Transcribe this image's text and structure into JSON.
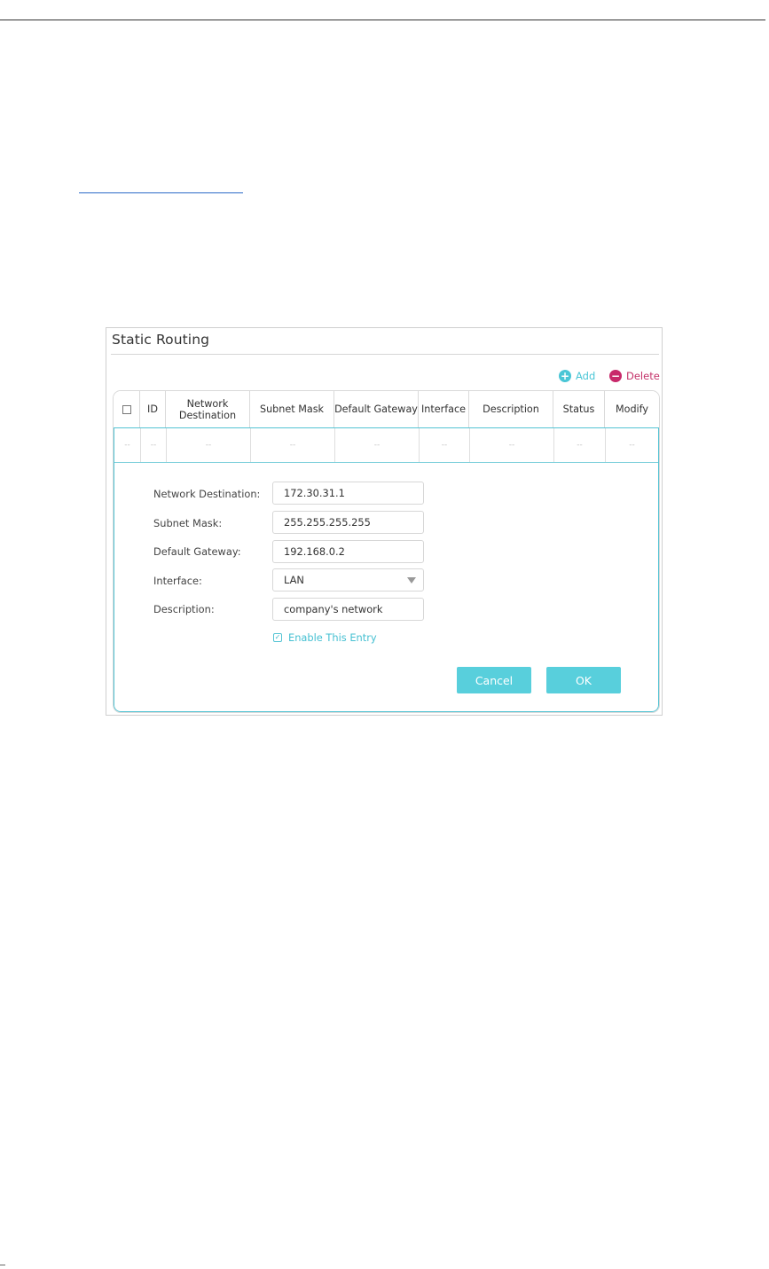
{
  "panel": {
    "title": "Static Routing",
    "actions": {
      "add": "Add",
      "delete": "Delete"
    }
  },
  "table": {
    "headers": {
      "id": "ID",
      "network_destination": "Network\nDestination",
      "subnet_mask": "Subnet Mask",
      "default_gateway": "Default Gateway",
      "interface": "Interface",
      "description": "Description",
      "status": "Status",
      "modify": "Modify"
    },
    "placeholder_row": [
      "--",
      "--",
      "--",
      "--",
      "--",
      "--",
      "--",
      "--",
      "--"
    ]
  },
  "form": {
    "network_destination": {
      "label": "Network Destination:",
      "value": "172.30.31.1"
    },
    "subnet_mask": {
      "label": "Subnet Mask:",
      "value": "255.255.255.255"
    },
    "default_gateway": {
      "label": "Default Gateway:",
      "value": "192.168.0.2"
    },
    "interface": {
      "label": "Interface:",
      "value": "LAN"
    },
    "description": {
      "label": "Description:",
      "value": "company's network"
    },
    "enable_entry": {
      "label": "Enable This Entry",
      "checked": true
    }
  },
  "buttons": {
    "cancel": "Cancel",
    "ok": "OK"
  },
  "colors": {
    "accent": "#58cfdc",
    "delete": "#c8286a",
    "text": "#333333"
  }
}
